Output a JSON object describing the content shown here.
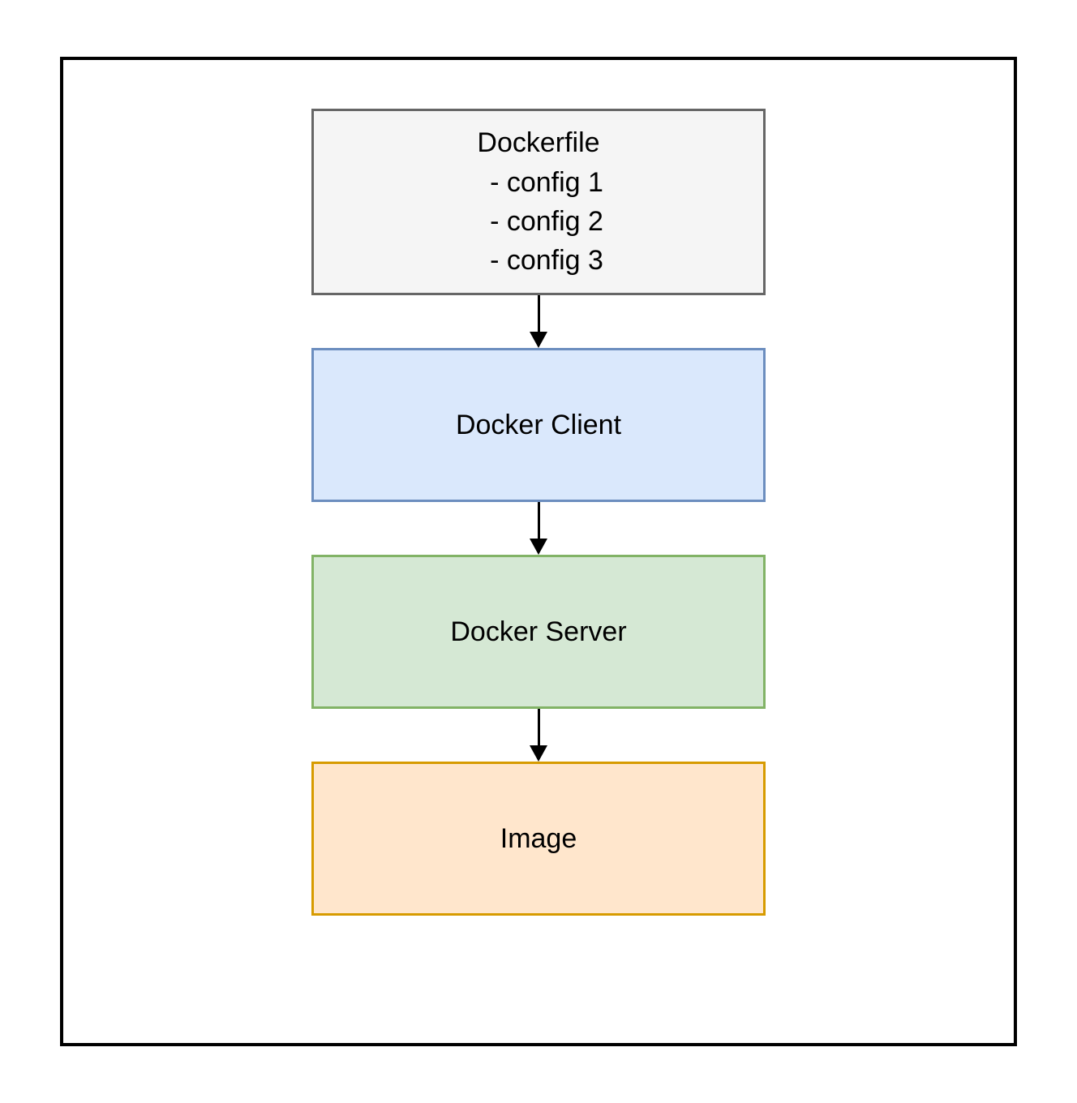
{
  "chart_data": {
    "type": "diagram",
    "flow": [
      {
        "id": "dockerfile",
        "label": "Dockerfile",
        "items": [
          "- config 1",
          "- config 2",
          "- config 3"
        ],
        "fill": "#f5f5f5",
        "stroke": "#666666"
      },
      {
        "id": "client",
        "label": "Docker Client",
        "fill": "#dae8fc",
        "stroke": "#6c8ebf"
      },
      {
        "id": "server",
        "label": "Docker Server",
        "fill": "#d5e8d4",
        "stroke": "#82b366"
      },
      {
        "id": "image",
        "label": "Image",
        "fill": "#ffe6cc",
        "stroke": "#d79b00"
      }
    ],
    "edges": [
      {
        "from": "dockerfile",
        "to": "client"
      },
      {
        "from": "client",
        "to": "server"
      },
      {
        "from": "server",
        "to": "image"
      }
    ]
  },
  "boxes": {
    "dockerfile": {
      "title": "Dockerfile",
      "config1": "- config 1",
      "config2": "- config 2",
      "config3": "- config 3"
    },
    "client": {
      "label": "Docker Client"
    },
    "server": {
      "label": "Docker Server"
    },
    "image": {
      "label": "Image"
    }
  }
}
